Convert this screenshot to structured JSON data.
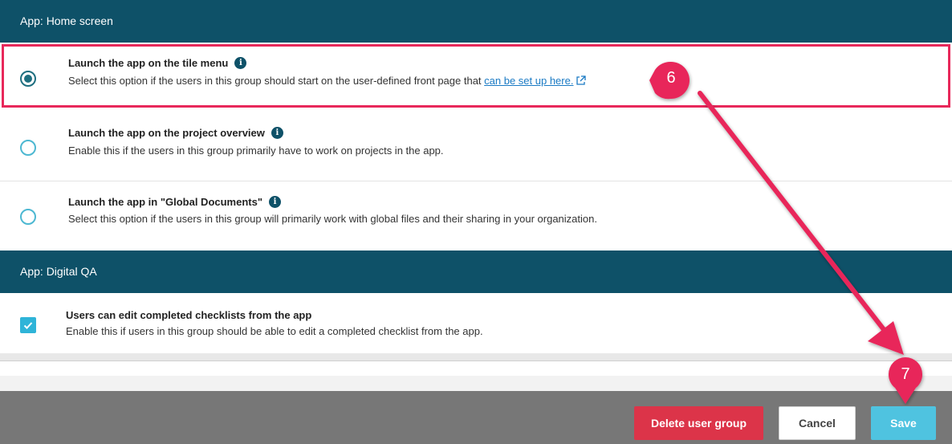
{
  "sections": {
    "home": {
      "title": "App: Home screen"
    },
    "qa": {
      "title": "App: Digital QA"
    }
  },
  "options": [
    {
      "title": "Launch the app on the tile menu",
      "desc_prefix": "Select this option if the users in this group should start on the user-defined front page that ",
      "link": "can be set up here.",
      "selected": true
    },
    {
      "title": "Launch the app on the project overview",
      "desc": "Enable this if the users in this group primarily have to work on projects in the app.",
      "selected": false
    },
    {
      "title": "Launch the app in \"Global Documents\"",
      "desc": "Select this option if the users in this group will primarily work with global files and their sharing in your organization.",
      "selected": false
    }
  ],
  "qa_option": {
    "title": "Users can edit completed checklists from the app",
    "desc": "Enable this if users in this group should be able to edit a completed checklist from the app.",
    "checked": true
  },
  "footer": {
    "delete_label": "Delete user group",
    "cancel_label": "Cancel",
    "save_label": "Save"
  },
  "annotations": {
    "step6": "6",
    "step7": "7"
  },
  "colors": {
    "header": "#0e5168",
    "highlight": "#e8285a",
    "delete": "#dc3449",
    "save": "#4fc3e0",
    "checkbox": "#2fb4d8"
  }
}
